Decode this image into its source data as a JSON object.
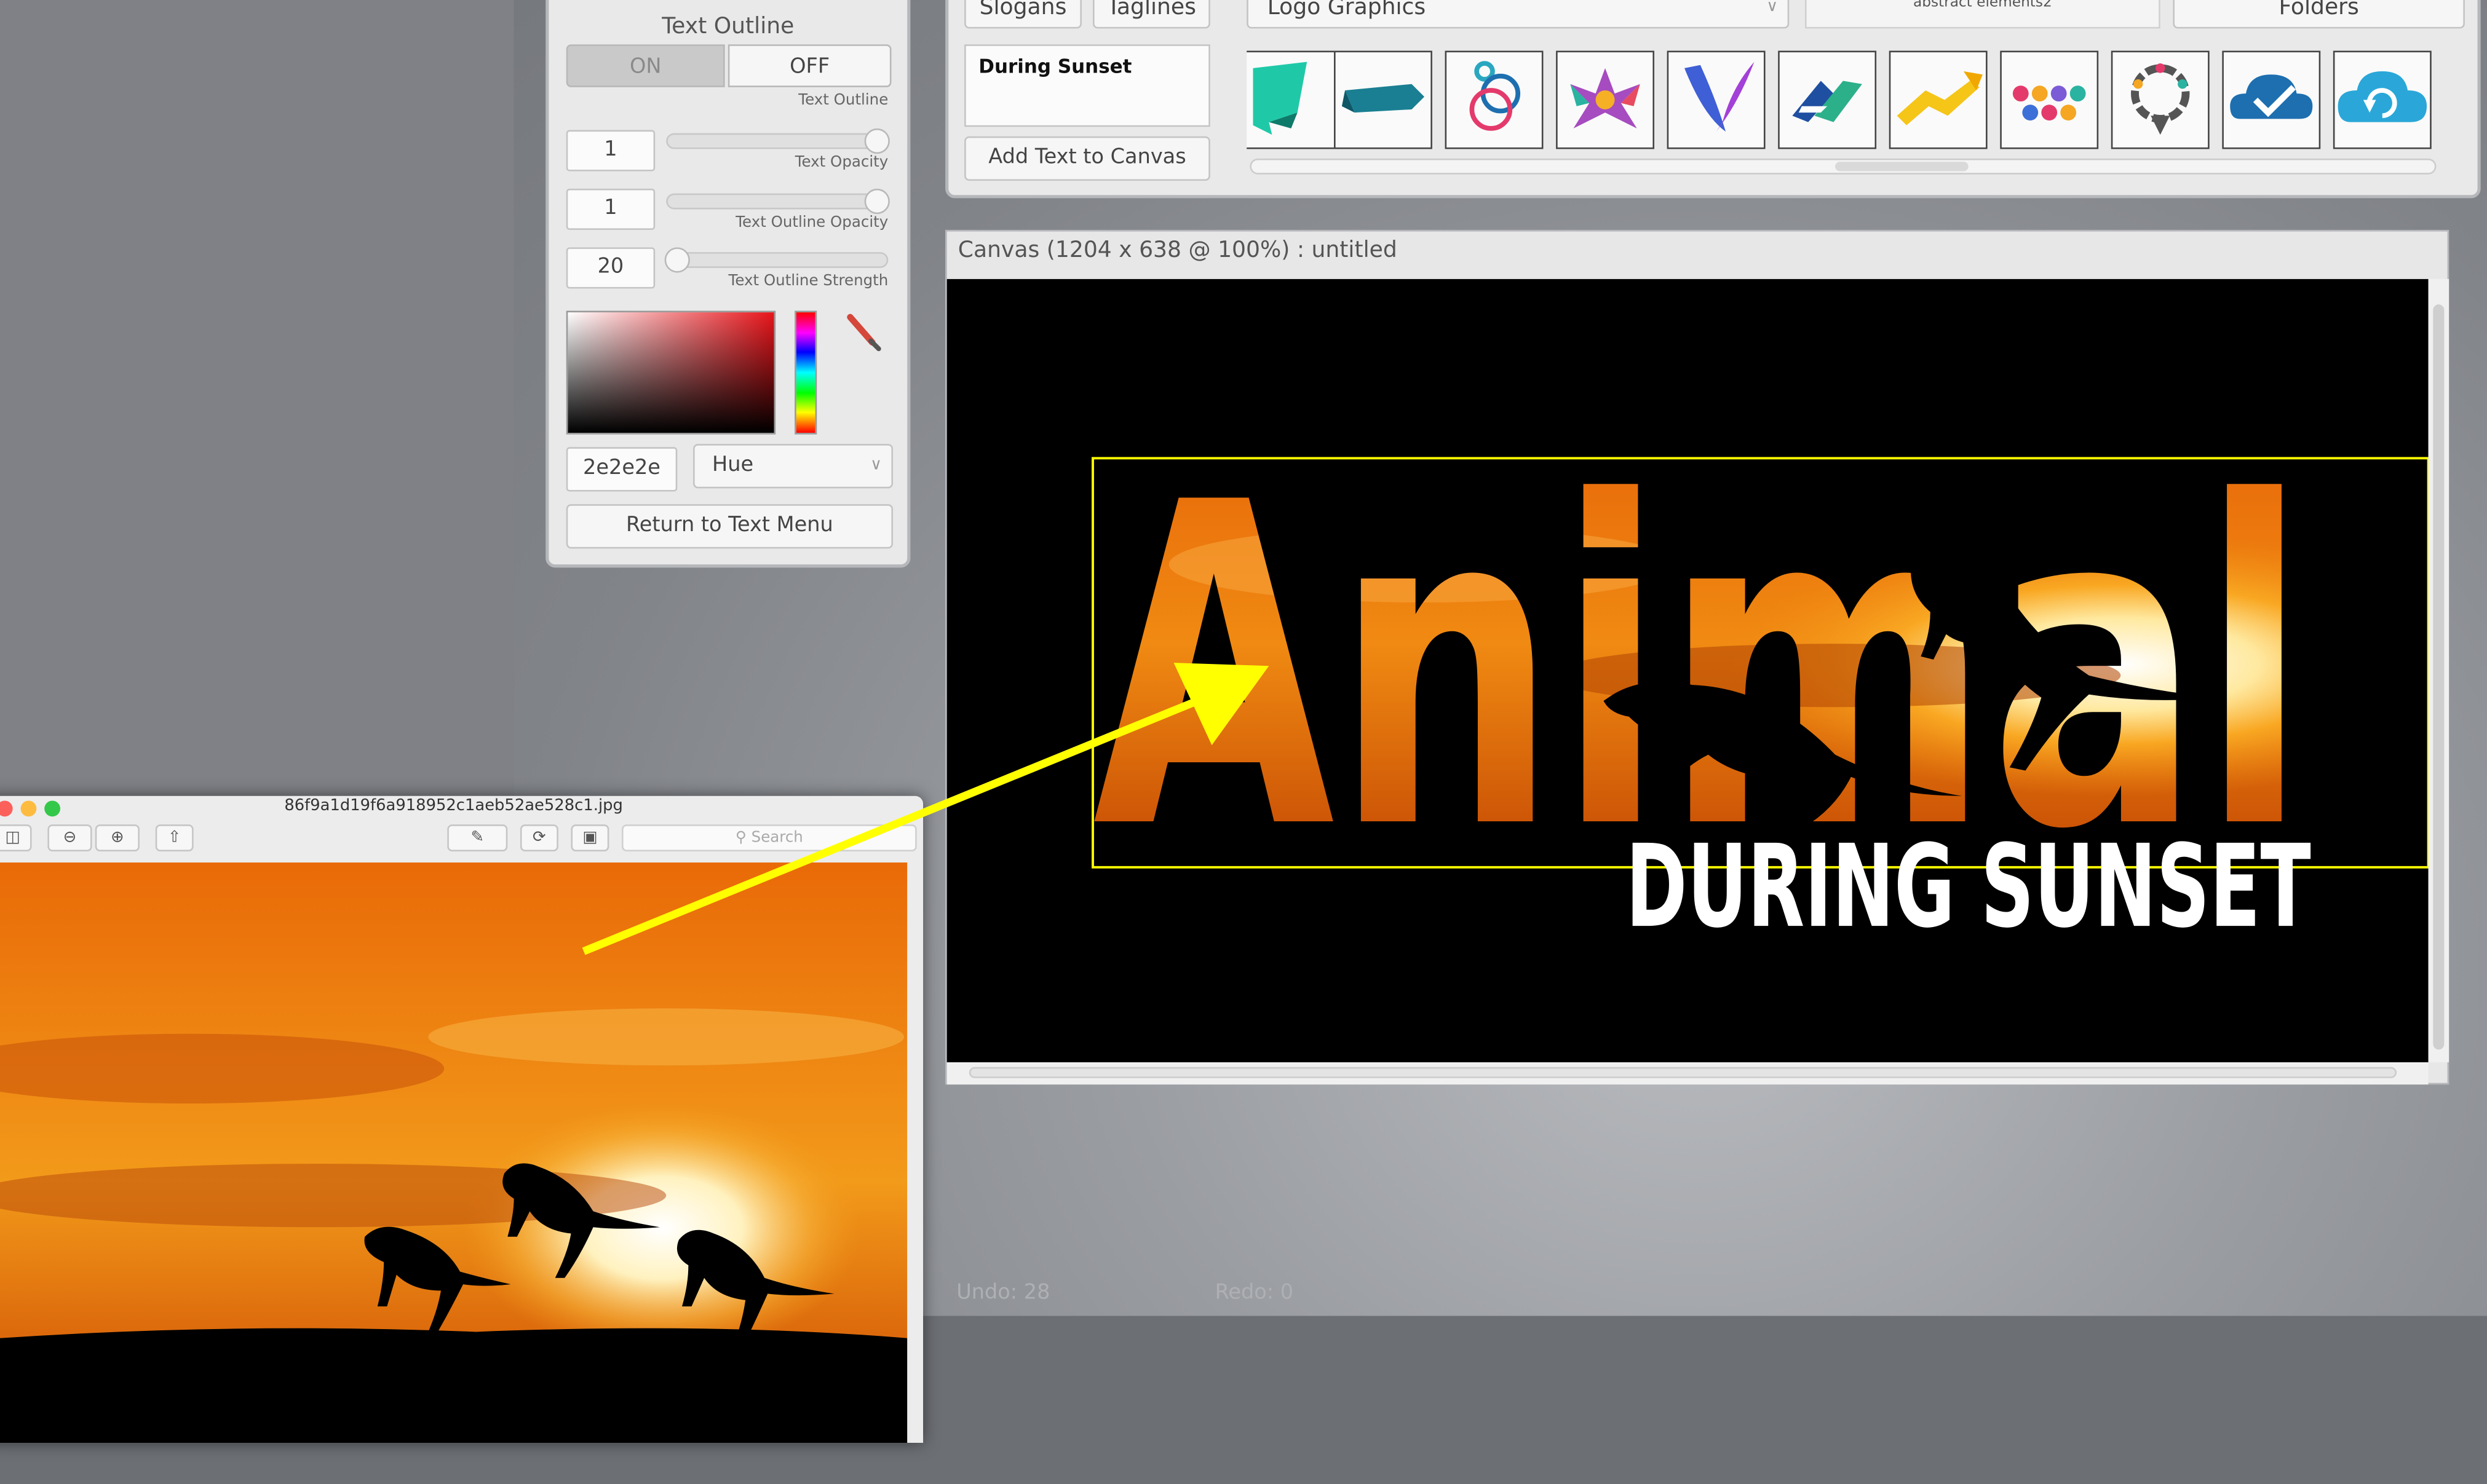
{
  "text_outline_panel": {
    "title": "Text Outline",
    "toggle_on": "ON",
    "toggle_off": "OFF",
    "toggle_selected": "OFF",
    "toggle_caption": "Text Outline",
    "text_opacity": {
      "value": "1",
      "label": "Text Opacity",
      "level": 1.0
    },
    "outline_opacity": {
      "value": "1",
      "label": "Text Outline Opacity",
      "level": 1.0
    },
    "outline_strength": {
      "value": "20",
      "label": "Text Outline Strength",
      "level": 0.0
    },
    "hex_value": "2e2e2e",
    "color_mode": "Hue",
    "return_button": "Return to Text Menu"
  },
  "top_panel": {
    "slogans_tab": "Slogans",
    "taglines_tab": "Taglines",
    "text_preview": "During Sunset",
    "add_button": "Add Text to Canvas",
    "logo_category": "Logo Graphics",
    "folder_name": "abstract elements2",
    "folders_button": "Folders",
    "thumbnails": [
      "green-ribbon-icon",
      "teal-banner-icon",
      "rings-icon",
      "star-people-icon",
      "wing-icon",
      "diamond-arrows-icon",
      "yellow-arrow-icon",
      "chain-dots-icon",
      "speech-ring-icon",
      "cloud-check-icon",
      "cloud-refresh-icon"
    ]
  },
  "canvas": {
    "title": "Canvas (1204 x 638 @ 100%) : untitled",
    "headline": "Animal",
    "subtitle": "DURING SUNSET",
    "selection_color": "#ffff00",
    "text_fill": "#ffffff"
  },
  "status": {
    "undo": "Undo: 28",
    "redo": "Redo: 0"
  },
  "preview_window": {
    "filename": "86f9a1d19f6a918952c1aeb52ae528c1.jpg",
    "search_placeholder": "Search"
  },
  "colors": {
    "accent_arrow": "#ffff00",
    "sunset_orange": "#f08a12"
  }
}
